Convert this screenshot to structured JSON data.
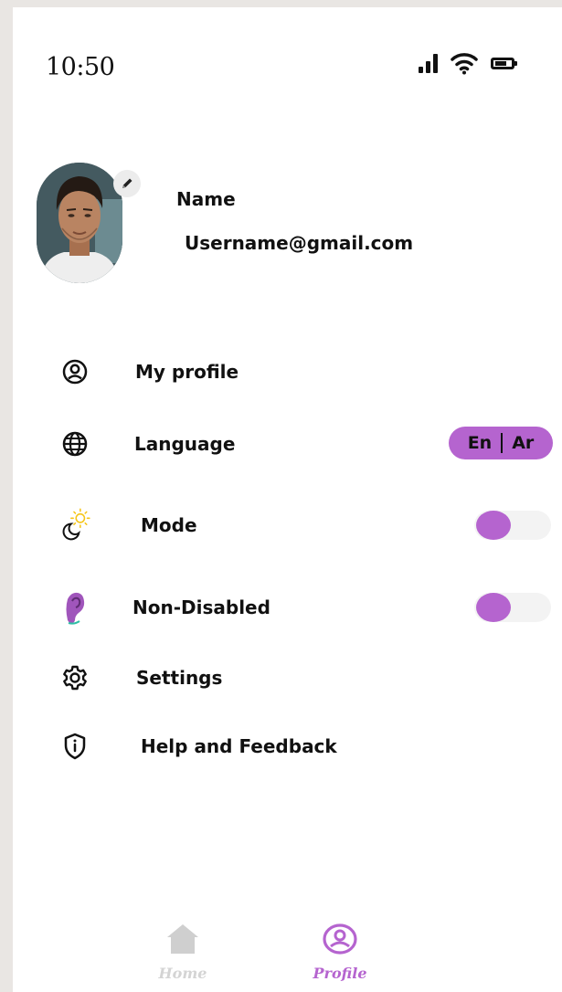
{
  "status_bar": {
    "time": "10:50"
  },
  "profile": {
    "name": "Name",
    "email": "Username@gmail.com"
  },
  "menu": {
    "my_profile": "My profile",
    "language": "Language",
    "language_options": [
      "En",
      "Ar"
    ],
    "mode": "Mode",
    "mode_toggle_on": false,
    "non_disabled": "Non-Disabled",
    "non_disabled_toggle_on": false,
    "settings": "Settings",
    "help": "Help and Feedback"
  },
  "tab_bar": {
    "home": "Home",
    "profile": "Profile",
    "active": "Profile"
  },
  "colors": {
    "accent": "#b564cf",
    "inactive_tab": "#cfcfcf",
    "text": "#111111",
    "sun": "#f5c518"
  }
}
